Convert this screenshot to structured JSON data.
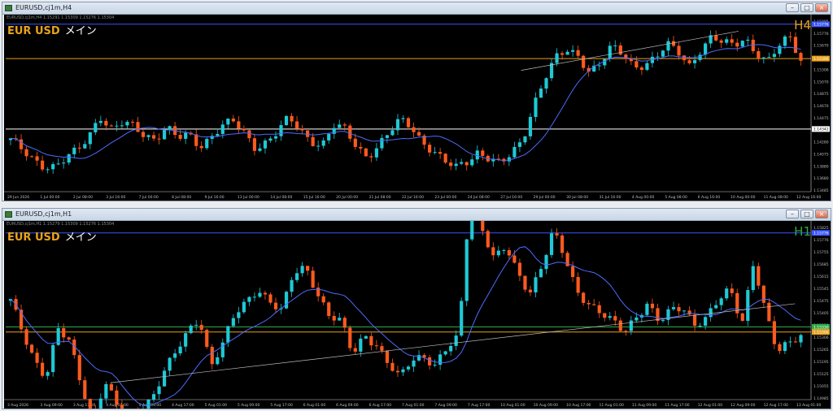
{
  "windows": [
    {
      "title": "EURUSD,cj1m,H4",
      "info_line": "EURUSD,cj1m,H4  1.15291 1.15309 1.15276 1.15304",
      "symbol": "EUR USD",
      "subtitle": "メイン",
      "timeframe": "H4",
      "timeframe_color": "#e8a21c",
      "chart_data": {
        "type": "candlestick",
        "ylim": [
          1.13485,
          1.15885
        ],
        "y_ticks": [
          "1.15885",
          "1.15776",
          "1.15670",
          "1.15475",
          "1.15306",
          "1.15070",
          "1.14875",
          "1.14670",
          "1.14475",
          "1.14342",
          "1.14280",
          "1.14075",
          "1.13880",
          "1.13680",
          "1.13485"
        ],
        "x_labels": [
          "29 Jun 2026",
          "1 Jul 00:00",
          "2 Jul 08:00",
          "3 Jul 16:00",
          "7 Jul 00:00",
          "8 Jul 08:00",
          "9 Jul 16:00",
          "13 Jul 00:00",
          "14 Jul 08:00",
          "15 Jul 16:00",
          "20 Jul 00:00",
          "21 Jul 08:00",
          "22 Jul 16:00",
          "23 Jul 00:00",
          "24 Jul 08:00",
          "27 Jul 16:00",
          "29 Jul 00:00",
          "30 Jul 08:00",
          "31 Jul 16:00",
          "4 Aug 00:00",
          "5 Aug 08:00",
          "6 Aug 16:00",
          "10 Aug 00:00",
          "11 Aug 08:00",
          "12 Aug 16:00"
        ],
        "horizontal_lines": [
          {
            "value": 1.15776,
            "label": "1.15776",
            "color": "#3b56ff"
          },
          {
            "value": 1.15306,
            "label": "1.15306",
            "color": "#e8a21c"
          },
          {
            "value": 1.14342,
            "label": "1.14342",
            "color": "#ffffff"
          }
        ],
        "ma_color": "#4d6bff",
        "trendline": [
          [
            0.64,
            1.15145
          ],
          [
            0.91,
            1.1568
          ]
        ],
        "price_path": [
          1.1418,
          1.1405,
          1.1395,
          1.1385,
          1.1382,
          1.1392,
          1.1405,
          1.1425,
          1.1455,
          1.1432,
          1.144,
          1.1438,
          1.1428,
          1.1422,
          1.1436,
          1.142,
          1.1426,
          1.1412,
          1.1425,
          1.1438,
          1.1443,
          1.1428,
          1.141,
          1.1418,
          1.143,
          1.1448,
          1.1432,
          1.142,
          1.1413,
          1.1438,
          1.1432,
          1.1412,
          1.1398,
          1.1412,
          1.1428,
          1.1445,
          1.1438,
          1.1418,
          1.1405,
          1.1388,
          1.138,
          1.139,
          1.1405,
          1.1395,
          1.1385,
          1.1398,
          1.142,
          1.147,
          1.1505,
          1.153,
          1.154,
          1.1535,
          1.1515,
          1.1525,
          1.1545,
          1.1535,
          1.152,
          1.1525,
          1.1533,
          1.1548,
          1.1538,
          1.1522,
          1.1545,
          1.156,
          1.155,
          1.1548,
          1.156,
          1.154,
          1.1525,
          1.1545,
          1.156,
          1.153
        ]
      }
    },
    {
      "title": "EURUSD,cj1m,H1",
      "info_line": "EURUSD,cj1m,H1  1.15279 1.15309 1.15276 1.15304",
      "symbol": "EUR USD",
      "subtitle": "メイン",
      "timeframe": "H1",
      "timeframe_color": "#2fa84a",
      "chart_data": {
        "type": "candlestick",
        "ylim": [
          1.14985,
          1.15825
        ],
        "y_ticks": [
          "1.15825",
          "1.15776",
          "1.15755",
          "1.15685",
          "1.15615",
          "1.15545",
          "1.15475",
          "1.15405",
          "1.15330",
          "1.15306",
          "1.15265",
          "1.15195",
          "1.15125",
          "1.15055",
          "1.14985"
        ],
        "x_labels": [
          "3 Aug 2026",
          "3 Aug 09:00",
          "3 Aug 17:00",
          "4 Aug 01:00",
          "4 Aug 09:00",
          "4 Aug 17:00",
          "5 Aug 01:00",
          "5 Aug 09:00",
          "5 Aug 17:00",
          "6 Aug 01:00",
          "6 Aug 09:00",
          "6 Aug 17:00",
          "7 Aug 01:00",
          "7 Aug 09:00",
          "7 Aug 17:00",
          "10 Aug 01:00",
          "10 Aug 09:00",
          "10 Aug 17:00",
          "11 Aug 01:00",
          "11 Aug 09:00",
          "11 Aug 17:00",
          "12 Aug 01:00",
          "12 Aug 09:00",
          "12 Aug 17:00",
          "13 Aug 01:00"
        ],
        "horizontal_lines": [
          {
            "value": 1.15776,
            "label": "1.15776",
            "color": "#3b56ff"
          },
          {
            "value": 1.1533,
            "label": "1.15330",
            "color": "#2fa84a"
          },
          {
            "value": 1.15306,
            "label": "1.15306",
            "color": "#e8a21c"
          }
        ],
        "ma_color": "#4d6bff",
        "trendline": [
          [
            0.13,
            1.15065
          ],
          [
            0.98,
            1.1544
          ]
        ],
        "price_path": [
          1.1545,
          1.153,
          1.1518,
          1.151,
          1.1532,
          1.1525,
          1.1505,
          1.149,
          1.1508,
          1.1495,
          1.1488,
          1.1495,
          1.15,
          1.1512,
          1.152,
          1.153,
          1.1538,
          1.1515,
          1.1525,
          1.1538,
          1.1545,
          1.1552,
          1.1545,
          1.154,
          1.1558,
          1.1562,
          1.155,
          1.1538,
          1.1535,
          1.152,
          1.153,
          1.1525,
          1.1515,
          1.1508,
          1.1518,
          1.152,
          1.1515,
          1.1522,
          1.1528,
          1.16,
          1.158,
          1.1565,
          1.157,
          1.1558,
          1.155,
          1.1562,
          1.1578,
          1.1565,
          1.155,
          1.1545,
          1.154,
          1.1535,
          1.153,
          1.1538,
          1.1545,
          1.1535,
          1.154,
          1.1542,
          1.1535,
          1.1538,
          1.1545,
          1.155,
          1.1535,
          1.1565,
          1.154,
          1.152,
          1.1525,
          1.153
        ]
      }
    }
  ]
}
